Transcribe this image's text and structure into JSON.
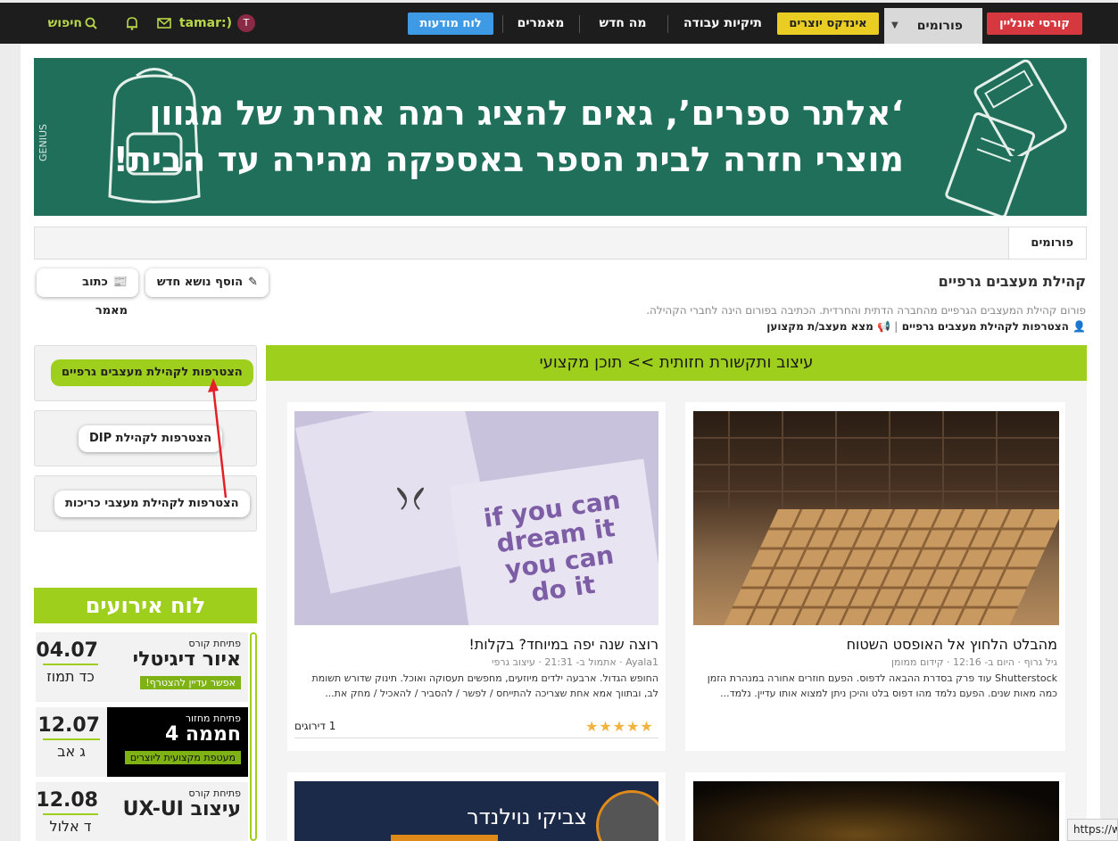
{
  "nav": {
    "courses": "קורסי אונליין",
    "forums": "פורומים",
    "index": "אינדקס יוצרים",
    "portfolios": "תיקיות עבודה",
    "whats_new": "מה חדש",
    "articles": "מאמרים",
    "board": "לוח מודעות",
    "username": "tamar:)",
    "avatar_letter": "T",
    "search": "חיפוש"
  },
  "banner": {
    "line1": "‘אלתר ספרים’, גאים להציג רמה אחרת של מגוון",
    "line2": "מוצרי חזרה לבית הספר באספקה מהירה עד הבית!",
    "brand": "GENIUS"
  },
  "breadcrumb": {
    "forums": "פורומים"
  },
  "community": {
    "title": "קהילת מעצבים גרפיים",
    "description": "פורום קהילת המעצבים הגרפיים מהחברה הדתית והחרדית. הכתיבה בפורום הינה לחברי הקהילה.",
    "join_link": "הצטרפות לקהילת מעצבים גרפיים",
    "find_link": "מצא מעצב/ת מקצוען"
  },
  "actions": {
    "new_topic": "הוסף נושא חדש",
    "write_article": "כתוב מאמר"
  },
  "sidebar": {
    "join_graphic": "הצטרפות לקהילת מעצבים גרפיים",
    "join_dip": "הצטרפות לקהילת DIP",
    "join_cover": "הצטרפות לקהילת מעצבי כריכות"
  },
  "events": {
    "heading": "לוח אירועים",
    "items": [
      {
        "date": "04.07",
        "hebdate": "כד תמוז",
        "kind": "פתיחת קורס",
        "title": "איור דיגיטלי",
        "tag": "אפשר עדיין להצטרף!"
      },
      {
        "date": "12.07",
        "hebdate": "ג אב",
        "kind": "פתיחת מחזור",
        "title": "חממה 4",
        "tag": "מעטפת מקצועית ליוצרים"
      },
      {
        "date": "12.08",
        "hebdate": "ד אלול",
        "kind": "פתיחת קורס",
        "title": "עיצוב UX-UI",
        "tag": ""
      }
    ]
  },
  "content": {
    "heading": "עיצוב ותקשורת חזותית >> תוכן מקצועי",
    "cards": [
      {
        "title": "מהבלט הלחוץ אל האופסט השטוח",
        "meta": "גיל גרוף · היום ב- 12:16 · קידום ממומן",
        "text": "Shutterstock עוד פרק בסדרת ההבאה לדפוס. הפעם חוזרים אחורה במנהרת הזמן כמה מאות שנים. הפעם נלמד מהו דפוס בלט והיכן ניתן למצוא אותו עדיין. נלמד..."
      },
      {
        "title": "רוצה שנה יפה במיוחד? בקלות!",
        "meta": "Ayala1 · אתמול ב- 21:31 · עיצוב גרפי",
        "text": "החופש הגדול. ארבעה ילדים מיוזעים, מחפשים תעסוקה ואוכל. תינוק שדורש תשומת לב, ובתווך אמא אחת שצריכה להתייחס / לפשר / להסביר / להאכיל / מחק את...",
        "ratings": "1 דירוגים",
        "stars": "★★★★★"
      }
    ],
    "card3_name": "צביקי נוילנדר"
  },
  "image_text": {
    "poster1": "if you can",
    "poster2": "dream it",
    "poster3": "you can",
    "poster4": "do it"
  },
  "status_url": "https://ww"
}
